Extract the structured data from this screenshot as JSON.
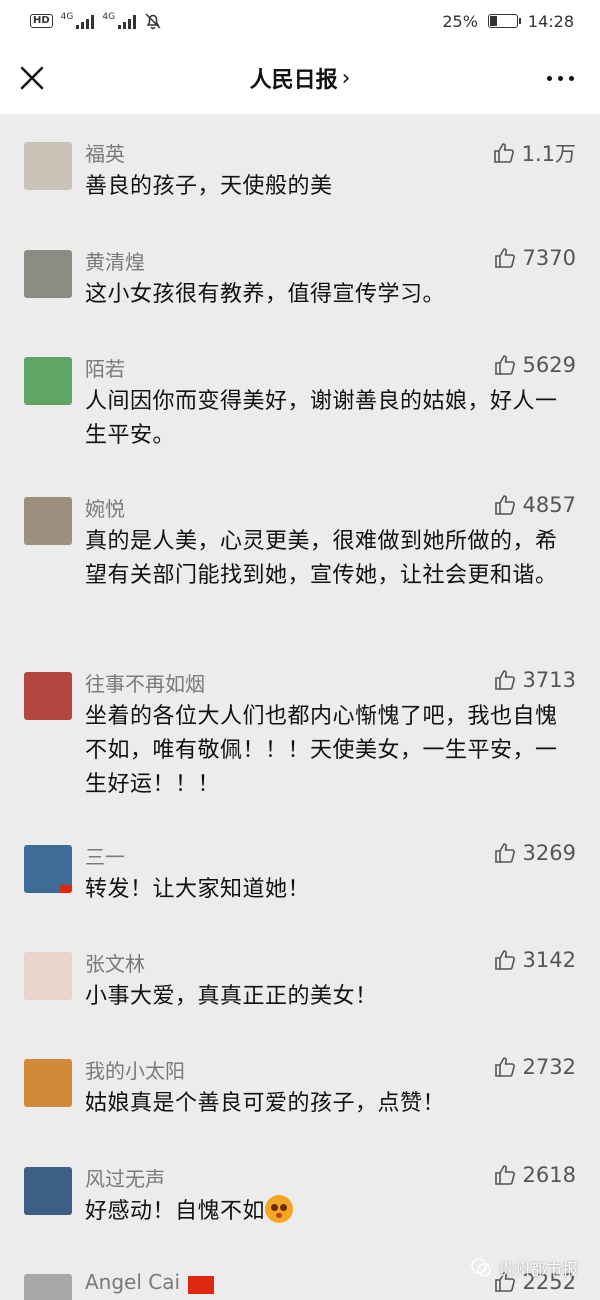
{
  "status_bar": {
    "hd": "HD",
    "net1": "4G",
    "net2": "4G",
    "battery_percent": "25%",
    "battery_level": 0.25,
    "time": "14:28"
  },
  "header": {
    "title": "人民日报",
    "chevron": "›"
  },
  "comments": [
    {
      "name": "福英",
      "likes": "1.1万",
      "text": "善良的孩子，天使般的美",
      "avatar_color": "#c9c2b6"
    },
    {
      "name": "黄清煌",
      "likes": "7370",
      "text": "这小女孩很有教养，值得宣传学习。",
      "avatar_color": "#8a8d84"
    },
    {
      "name": "陌若",
      "likes": "5629",
      "text": "人间因你而变得美好，谢谢善良的姑娘，好人一生平安。",
      "avatar_color": "#5fa566"
    },
    {
      "name": "婉悦",
      "likes": "4857",
      "text": "真的是人美，心灵更美，很难做到她所做的，希望有关部门能找到她，宣传她，让社会更和谐。",
      "avatar_color": "#9c8f7d"
    },
    {
      "name": "往事不再如烟",
      "likes": "3713",
      "text": "坐着的各位大人们也都内心惭愧了吧，我也自愧不如，唯有敬佩！！！天使美女，一生平安，一生好运！！！",
      "avatar_color": "#b5463f"
    },
    {
      "name": "三一",
      "likes": "3269",
      "text": "转发！让大家知道她！",
      "avatar_color": "#3e6c97"
    },
    {
      "name": "张文林",
      "likes": "3142",
      "text": "小事大爱，真真正正的美女！",
      "avatar_color": "#e9d5cc"
    },
    {
      "name": "我的小太阳",
      "likes": "2732",
      "text": "姑娘真是个善良可爱的孩子，点赞！",
      "avatar_color": "#d08a3a"
    },
    {
      "name": "风过无声",
      "likes": "2618",
      "text": "好感动！自愧不如",
      "avatar_color": "#3d5f83"
    },
    {
      "name": "Angel Cai",
      "likes": "2252",
      "text": "",
      "avatar_color": "#a8a8a8"
    }
  ],
  "watermark": "贵州都市报"
}
